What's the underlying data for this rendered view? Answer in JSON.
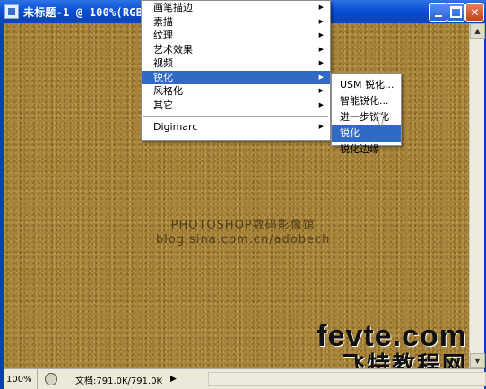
{
  "titlebar": {
    "title": "未标题-1 @ 100%(RGB/"
  },
  "menu": {
    "items": [
      {
        "label": "画笔描边",
        "has_submenu": true
      },
      {
        "label": "素描",
        "has_submenu": true
      },
      {
        "label": "纹理",
        "has_submenu": true
      },
      {
        "label": "艺术效果",
        "has_submenu": true
      },
      {
        "label": "视频",
        "has_submenu": true
      },
      {
        "label": "锐化",
        "has_submenu": true,
        "active": true
      },
      {
        "label": "风格化",
        "has_submenu": true
      },
      {
        "label": "其它",
        "has_submenu": true
      }
    ],
    "extra": {
      "label": "Digimarc",
      "has_submenu": true
    }
  },
  "submenu": {
    "items": [
      {
        "label": "USM 锐化..."
      },
      {
        "label": "智能锐化..."
      },
      {
        "label": "进一步锐化"
      },
      {
        "label": "锐化",
        "active": true
      },
      {
        "label": "锐化边缘"
      }
    ]
  },
  "canvas": {
    "watermark_line1": "PHOTOSHOP数码影像馆",
    "watermark_line2": "blog.sina.com.cn/adobech",
    "brand_line1": "fevte.com",
    "brand_line2": "飞特教程网",
    "color": "#a88235"
  },
  "statusbar": {
    "zoom": "100%",
    "doc_info": "文档:791.0K/791.0K"
  },
  "colors": {
    "menu_highlight": "#316ac5",
    "titlebar": "#0a4fd4"
  }
}
